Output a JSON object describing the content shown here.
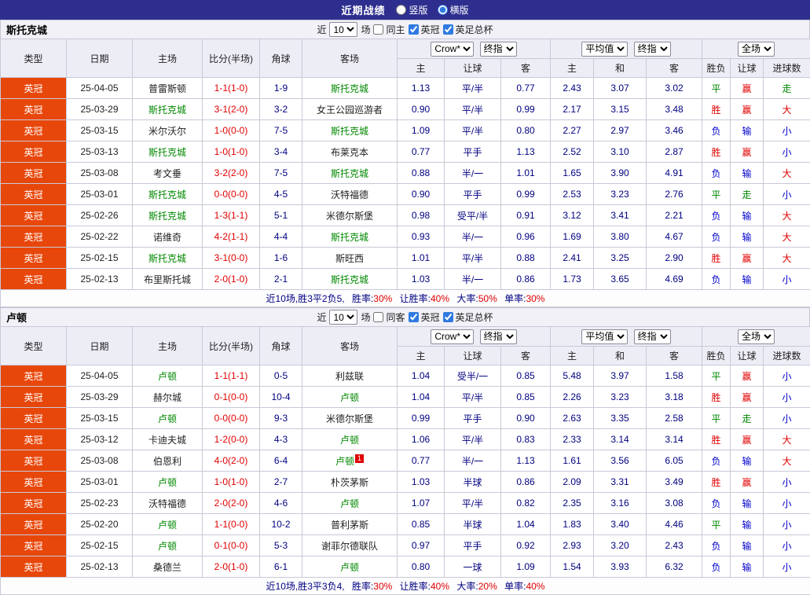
{
  "topbar": {
    "title": "近期战绩",
    "layout_options": [
      {
        "label": "竖版",
        "selected": false
      },
      {
        "label": "横版",
        "selected": true
      }
    ]
  },
  "table": {
    "col_headers": [
      "类型",
      "日期",
      "主场",
      "比分(半场)",
      "角球",
      "客场"
    ],
    "odds_sub_headers": [
      "主",
      "让球",
      "客"
    ],
    "avg_sub_headers": [
      "主",
      "和",
      "客"
    ],
    "result_sub_headers": [
      "胜负",
      "让球",
      "进球数"
    ],
    "dropdowns": {
      "bookmaker": "Crow*",
      "odds_time": "终指",
      "avg": "平均值",
      "avg_time": "终指",
      "scope": "全场"
    }
  },
  "colors": {
    "header_bar": "#2e2e8f",
    "league_badge": "#e8470b",
    "win_red": "#e00000",
    "lose_blue": "#0000cc",
    "draw_green": "#008800",
    "odds_navy": "#000080"
  },
  "sections": [
    {
      "team": "斯托克城",
      "filters": {
        "recent_label": "近",
        "count": "10",
        "games_label": "场",
        "same_label": "同主",
        "same_checked": false,
        "league1": "英冠",
        "league1_checked": true,
        "league2": "英足总杯",
        "league2_checked": true
      },
      "rows": [
        {
          "type": "英冠",
          "date": "25-04-05",
          "home": "普雷斯顿",
          "score": "1-1(1-0)",
          "corner": "1-9",
          "away": "斯托克城",
          "o1": "1.13",
          "hcap": "平/半",
          "o2": "0.77",
          "a1": "2.43",
          "a2": "3.07",
          "a3": "3.02",
          "res": "平",
          "hres": "赢",
          "gres": "走"
        },
        {
          "type": "英冠",
          "date": "25-03-29",
          "home": "斯托克城",
          "score": "3-1(2-0)",
          "corner": "3-2",
          "away": "女王公园巡游者",
          "o1": "0.90",
          "hcap": "平/半",
          "o2": "0.99",
          "a1": "2.17",
          "a2": "3.15",
          "a3": "3.48",
          "res": "胜",
          "hres": "赢",
          "gres": "大"
        },
        {
          "type": "英冠",
          "date": "25-03-15",
          "home": "米尔沃尔",
          "score": "1-0(0-0)",
          "corner": "7-5",
          "away": "斯托克城",
          "o1": "1.09",
          "hcap": "平/半",
          "o2": "0.80",
          "a1": "2.27",
          "a2": "2.97",
          "a3": "3.46",
          "res": "负",
          "hres": "输",
          "gres": "小"
        },
        {
          "type": "英冠",
          "date": "25-03-13",
          "home": "斯托克城",
          "score": "1-0(1-0)",
          "corner": "3-4",
          "away": "布莱克本",
          "o1": "0.77",
          "hcap": "平手",
          "o2": "1.13",
          "a1": "2.52",
          "a2": "3.10",
          "a3": "2.87",
          "res": "胜",
          "hres": "赢",
          "gres": "小"
        },
        {
          "type": "英冠",
          "date": "25-03-08",
          "home": "考文垂",
          "score": "3-2(2-0)",
          "corner": "7-5",
          "away": "斯托克城",
          "o1": "0.88",
          "hcap": "半/一",
          "o2": "1.01",
          "a1": "1.65",
          "a2": "3.90",
          "a3": "4.91",
          "res": "负",
          "hres": "输",
          "gres": "大"
        },
        {
          "type": "英冠",
          "date": "25-03-01",
          "home": "斯托克城",
          "score": "0-0(0-0)",
          "corner": "4-5",
          "away": "沃特福德",
          "o1": "0.90",
          "hcap": "平手",
          "o2": "0.99",
          "a1": "2.53",
          "a2": "3.23",
          "a3": "2.76",
          "res": "平",
          "hres": "走",
          "gres": "小"
        },
        {
          "type": "英冠",
          "date": "25-02-26",
          "home": "斯托克城",
          "score": "1-3(1-1)",
          "corner": "5-1",
          "away": "米德尔斯堡",
          "o1": "0.98",
          "hcap": "受平/半",
          "o2": "0.91",
          "a1": "3.12",
          "a2": "3.41",
          "a3": "2.21",
          "res": "负",
          "hres": "输",
          "gres": "大"
        },
        {
          "type": "英冠",
          "date": "25-02-22",
          "home": "诺维奇",
          "score": "4-2(1-1)",
          "corner": "4-4",
          "away": "斯托克城",
          "o1": "0.93",
          "hcap": "半/一",
          "o2": "0.96",
          "a1": "1.69",
          "a2": "3.80",
          "a3": "4.67",
          "res": "负",
          "hres": "输",
          "gres": "大"
        },
        {
          "type": "英冠",
          "date": "25-02-15",
          "home": "斯托克城",
          "score": "3-1(0-0)",
          "corner": "1-6",
          "away": "斯旺西",
          "o1": "1.01",
          "hcap": "平/半",
          "o2": "0.88",
          "a1": "2.41",
          "a2": "3.25",
          "a3": "2.90",
          "res": "胜",
          "hres": "赢",
          "gres": "大"
        },
        {
          "type": "英冠",
          "date": "25-02-13",
          "home": "布里斯托城",
          "score": "2-0(1-0)",
          "corner": "2-1",
          "away": "斯托克城",
          "o1": "1.03",
          "hcap": "半/一",
          "o2": "0.86",
          "a1": "1.73",
          "a2": "3.65",
          "a3": "4.69",
          "res": "负",
          "hres": "输",
          "gres": "小"
        }
      ],
      "summary": {
        "prefix": "近10场,胜3平2负5,",
        "stats": [
          {
            "label": "胜率:",
            "value": "30%"
          },
          {
            "label": "让胜率:",
            "value": "40%"
          },
          {
            "label": "大率:",
            "value": "50%"
          },
          {
            "label": "单率:",
            "value": "30%"
          }
        ]
      }
    },
    {
      "team": "卢顿",
      "filters": {
        "recent_label": "近",
        "count": "10",
        "games_label": "场",
        "same_label": "同客",
        "same_checked": false,
        "league1": "英冠",
        "league1_checked": true,
        "league2": "英足总杯",
        "league2_checked": true
      },
      "rows": [
        {
          "type": "英冠",
          "date": "25-04-05",
          "home": "卢顿",
          "score": "1-1(1-1)",
          "corner": "0-5",
          "away": "利兹联",
          "o1": "1.04",
          "hcap": "受半/一",
          "o2": "0.85",
          "a1": "5.48",
          "a2": "3.97",
          "a3": "1.58",
          "res": "平",
          "hres": "赢",
          "gres": "小"
        },
        {
          "type": "英冠",
          "date": "25-03-29",
          "home": "赫尔城",
          "score": "0-1(0-0)",
          "corner": "10-4",
          "away": "卢顿",
          "o1": "1.04",
          "hcap": "平/半",
          "o2": "0.85",
          "a1": "2.26",
          "a2": "3.23",
          "a3": "3.18",
          "res": "胜",
          "hres": "赢",
          "gres": "小"
        },
        {
          "type": "英冠",
          "date": "25-03-15",
          "home": "卢顿",
          "score": "0-0(0-0)",
          "corner": "9-3",
          "away": "米德尔斯堡",
          "o1": "0.99",
          "hcap": "平手",
          "o2": "0.90",
          "a1": "2.63",
          "a2": "3.35",
          "a3": "2.58",
          "res": "平",
          "hres": "走",
          "gres": "小"
        },
        {
          "type": "英冠",
          "date": "25-03-12",
          "home": "卡迪夫城",
          "score": "1-2(0-0)",
          "corner": "4-3",
          "away": "卢顿",
          "o1": "1.06",
          "hcap": "平/半",
          "o2": "0.83",
          "a1": "2.33",
          "a2": "3.14",
          "a3": "3.14",
          "res": "胜",
          "hres": "赢",
          "gres": "大"
        },
        {
          "type": "英冠",
          "date": "25-03-08",
          "home": "伯恩利",
          "score": "4-0(2-0)",
          "corner": "6-4",
          "away": "卢顿",
          "card": "1",
          "o1": "0.77",
          "hcap": "半/一",
          "o2": "1.13",
          "a1": "1.61",
          "a2": "3.56",
          "a3": "6.05",
          "res": "负",
          "hres": "输",
          "gres": "大"
        },
        {
          "type": "英冠",
          "date": "25-03-01",
          "home": "卢顿",
          "score": "1-0(1-0)",
          "corner": "2-7",
          "away": "朴茨茅斯",
          "o1": "1.03",
          "hcap": "半球",
          "o2": "0.86",
          "a1": "2.09",
          "a2": "3.31",
          "a3": "3.49",
          "res": "胜",
          "hres": "赢",
          "gres": "小"
        },
        {
          "type": "英冠",
          "date": "25-02-23",
          "home": "沃特福德",
          "score": "2-0(2-0)",
          "corner": "4-6",
          "away": "卢顿",
          "o1": "1.07",
          "hcap": "平/半",
          "o2": "0.82",
          "a1": "2.35",
          "a2": "3.16",
          "a3": "3.08",
          "res": "负",
          "hres": "输",
          "gres": "小"
        },
        {
          "type": "英冠",
          "date": "25-02-20",
          "home": "卢顿",
          "score": "1-1(0-0)",
          "corner": "10-2",
          "away": "普利茅斯",
          "o1": "0.85",
          "hcap": "半球",
          "o2": "1.04",
          "a1": "1.83",
          "a2": "3.40",
          "a3": "4.46",
          "res": "平",
          "hres": "输",
          "gres": "小"
        },
        {
          "type": "英冠",
          "date": "25-02-15",
          "home": "卢顿",
          "score": "0-1(0-0)",
          "corner": "5-3",
          "away": "谢菲尔德联队",
          "o1": "0.97",
          "hcap": "平手",
          "o2": "0.92",
          "a1": "2.93",
          "a2": "3.20",
          "a3": "2.43",
          "res": "负",
          "hres": "输",
          "gres": "小"
        },
        {
          "type": "英冠",
          "date": "25-02-13",
          "home": "桑德兰",
          "score": "2-0(1-0)",
          "corner": "6-1",
          "away": "卢顿",
          "o1": "0.80",
          "hcap": "一球",
          "o2": "1.09",
          "a1": "1.54",
          "a2": "3.93",
          "a3": "6.32",
          "res": "负",
          "hres": "输",
          "gres": "小"
        }
      ],
      "summary": {
        "prefix": "近10场,胜3平3负4,",
        "stats": [
          {
            "label": "胜率:",
            "value": "30%"
          },
          {
            "label": "让胜率:",
            "value": "40%"
          },
          {
            "label": "大率:",
            "value": "20%"
          },
          {
            "label": "单率:",
            "value": "40%"
          }
        ]
      }
    }
  ]
}
